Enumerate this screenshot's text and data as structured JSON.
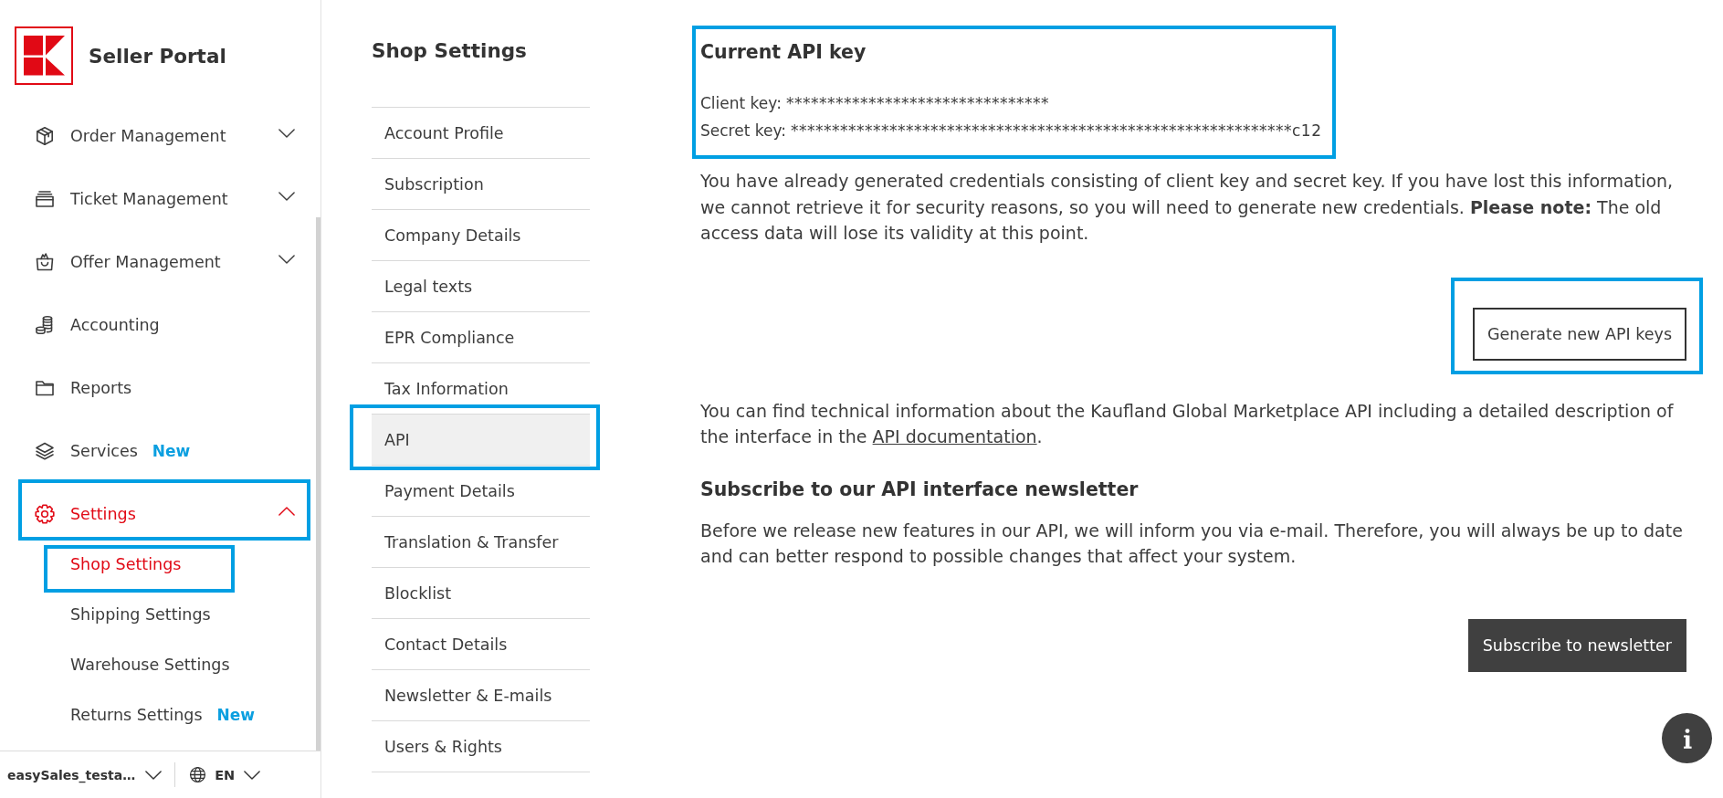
{
  "sidebar": {
    "title": "Seller Portal",
    "nav": [
      {
        "label": "Order Management",
        "kind": "group",
        "expanded": false,
        "selected": false,
        "highlighted": false
      },
      {
        "label": "Ticket Management",
        "kind": "group",
        "expanded": false,
        "selected": false,
        "highlighted": false
      },
      {
        "label": "Offer Management",
        "kind": "group",
        "expanded": false,
        "selected": false,
        "highlighted": false
      },
      {
        "label": "Accounting",
        "kind": "link",
        "selected": false,
        "highlighted": false
      },
      {
        "label": "Reports",
        "kind": "link",
        "selected": false,
        "highlighted": false
      },
      {
        "label": "Services",
        "kind": "link",
        "badge": "New",
        "selected": false,
        "highlighted": false
      },
      {
        "label": "Settings",
        "kind": "group",
        "expanded": true,
        "selected": true,
        "highlighted": true,
        "children": [
          {
            "label": "Shop Settings",
            "selected": true,
            "highlighted": true
          },
          {
            "label": "Shipping Settings",
            "selected": false,
            "highlighted": false
          },
          {
            "label": "Warehouse Settings",
            "selected": false,
            "highlighted": false
          },
          {
            "label": "Returns Settings",
            "badge": "New",
            "selected": false,
            "highlighted": false
          }
        ]
      }
    ],
    "account": "easySales_testa…",
    "language": "EN"
  },
  "shop_settings": {
    "title": "Shop Settings",
    "items": [
      {
        "label": "Account Profile",
        "selected": false,
        "highlighted": false
      },
      {
        "label": "Subscription",
        "selected": false,
        "highlighted": false
      },
      {
        "label": "Company Details",
        "selected": false,
        "highlighted": false
      },
      {
        "label": "Legal texts",
        "selected": false,
        "highlighted": false
      },
      {
        "label": "EPR Compliance",
        "selected": false,
        "highlighted": false
      },
      {
        "label": "Tax Information",
        "selected": false,
        "highlighted": false
      },
      {
        "label": "API",
        "selected": true,
        "highlighted": true
      },
      {
        "label": "Payment Details",
        "selected": false,
        "highlighted": false
      },
      {
        "label": "Translation & Transfer",
        "selected": false,
        "highlighted": false
      },
      {
        "label": "Blocklist",
        "selected": false,
        "highlighted": false
      },
      {
        "label": "Contact Details",
        "selected": false,
        "highlighted": false
      },
      {
        "label": "Newsletter & E-mails",
        "selected": false,
        "highlighted": false
      },
      {
        "label": "Users & Rights",
        "selected": false,
        "highlighted": false
      }
    ]
  },
  "api_key": {
    "title": "Current API key",
    "highlighted": true,
    "keys": [
      {
        "label": "Client key:",
        "value": "********************************"
      },
      {
        "label": "Secret key:",
        "value": "*************************************************************c12"
      }
    ],
    "notice": "You have already generated credentials consisting of client key and secret key. If you have lost this information, we cannot retrieve it for security reasons, so you will need to generate new credentials. **Please note:** The old access data will lose its validity at this point.",
    "generate_button": {
      "label": "Generate new API keys",
      "highlighted": true
    }
  },
  "documentation": {
    "text": "You can find technical information about the Kaufland Global Marketplace API including a detailed description of the interface in the ",
    "link": "API documentation",
    "text_end": "."
  },
  "newsletter": {
    "title": "Subscribe to our API interface newsletter",
    "text": "Before we release new features in our API, we will inform you via e-mail. Therefore, you will always be up to date and can better respond to possible changes that affect your system.",
    "button": "Subscribe to newsletter"
  }
}
